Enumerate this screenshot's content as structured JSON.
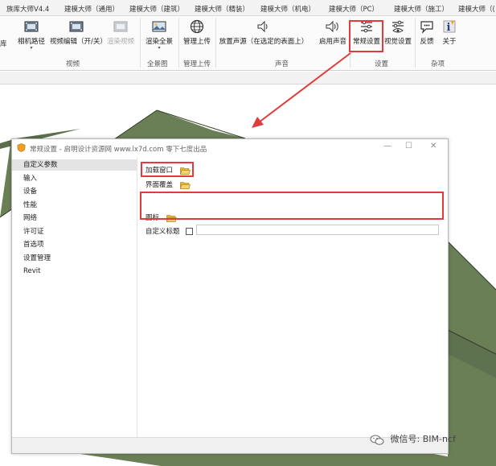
{
  "ribbon_tabs": [
    "族库大师V4.4",
    "建模大师（通用）",
    "建模大师（建筑）",
    "建模大师（精装）",
    "建模大师（机电）",
    "建模大师（PC）",
    "建模大师（施工）",
    "建模大师（("
  ],
  "ribbon": {
    "left_cut_label": "库",
    "buttons": {
      "camera_path": "相机路径",
      "video_edit": "视频编辑（开/关）",
      "render_video": "渲染视频",
      "render_panorama": "渲染全景",
      "manage_upload": "管理上传",
      "place_sound": "放置声源（在选定的表面上）",
      "enable_sound": "启用声音",
      "general_settings": "常规设置",
      "visual_settings": "视觉设置",
      "feedback": "反馈",
      "about": "关于"
    },
    "groups": {
      "video": "视频",
      "panorama": "全景图",
      "upload": "管理上传",
      "sound": "声音",
      "settings": "设置",
      "misc": "杂项"
    }
  },
  "dialog": {
    "title": "常规设置 - 启明设计资源网 www.lx7d.com 零下七度出品",
    "nav_items": [
      "自定义参数",
      "输入",
      "设备",
      "性能",
      "网络",
      "许可证",
      "首选项",
      "设置管理",
      "Revit"
    ],
    "selected_nav": "自定义参数",
    "fields": {
      "load_window": "加载窗口",
      "interface_cover": "界面覆盖",
      "icon": "图标",
      "custom_title": "自定义标题",
      "custom_title_value": "",
      "custom_title_checked": false
    }
  },
  "watermark": "微信号: BIM-ncf",
  "colors": {
    "highlight_red": "#e23b3b",
    "model_green": "#6b7f57",
    "folder_yellow": "#e7b431"
  }
}
